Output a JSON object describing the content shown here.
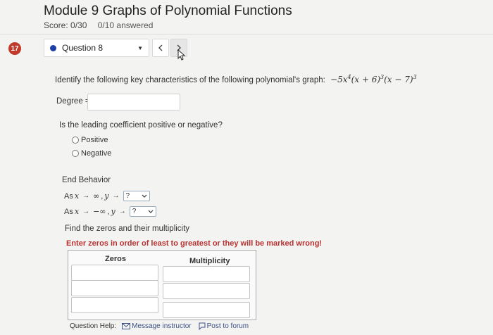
{
  "header": {
    "title": "Module 9 Graphs of Polynomial Functions",
    "score": "Score: 0/30",
    "answered": "0/10 answered"
  },
  "question_nav": {
    "number_badge": "17",
    "selected": "Question 8",
    "prev_icon": "chevron-left-icon",
    "next_icon": "chevron-right-icon"
  },
  "problem": {
    "prompt": "Identify the following key characteristics of the following polynomial's graph:",
    "expr_coef": "−5x",
    "exp1": "4",
    "factor2": "(x + 6)",
    "exp2": "3",
    "factor3": "(x − 7)",
    "exp3": "3"
  },
  "degree": {
    "label": "Degree =",
    "value": ""
  },
  "leading_coefficient": {
    "question": "Is the leading coefficient positive or negative?",
    "options": [
      "Positive",
      "Negative"
    ]
  },
  "end_behavior": {
    "title": "End Behavior",
    "row1_prefix": "As",
    "row1_x": "x",
    "row1_target": "∞",
    "row1_y": "y",
    "row2_prefix": "As",
    "row2_x": "x",
    "row2_target": "−∞",
    "row2_y": "y",
    "select_value": "?"
  },
  "zeros": {
    "title": "Find the zeros and their multiplicity",
    "warning": "Enter zeros in order of least to greatest or they will be marked wrong!",
    "col_zeros": "Zeros",
    "col_multiplicity": "Multiplicity"
  },
  "help": {
    "label": "Question Help:",
    "message_link": "Message instructor",
    "post_link": "Post to forum"
  },
  "colors": {
    "badge": "#c0392b",
    "dot": "#1f3fa8",
    "warning": "#b83232"
  }
}
